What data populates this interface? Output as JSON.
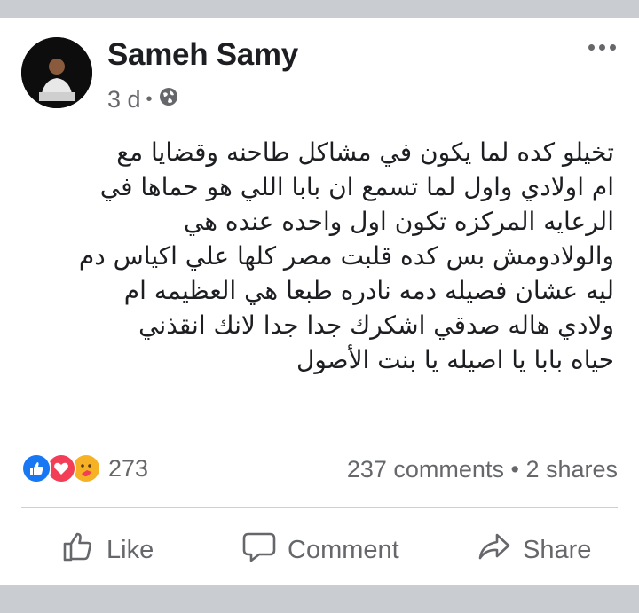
{
  "post": {
    "author": "Sameh Samy",
    "time": "3 d",
    "text_lines": [
      "تخيلو كده لما يكون في مشاكل طاحنه وقضايا مع",
      "ام اولادي واول لما تسمع ان بابا اللي هو حماها في",
      "الرعايه المركزه تكون اول واحده عنده هي",
      "والولادومش بس كده قلبت مصر كلها علي اكياس دم",
      "ليه عشان فصيله دمه نادره طبعا هي العظيمه ام",
      "ولادي هاله صدقي اشكرك جدا جدا لانك انقذني",
      "حياه بابا يا اصيله يا بنت الأصول"
    ]
  },
  "reactions": {
    "count": "273",
    "comments": "237 comments",
    "shares": "2 shares",
    "separator": "•"
  },
  "actions": {
    "like": "Like",
    "comment": "Comment",
    "share": "Share"
  },
  "colors": {
    "like_blue": "#1877f2",
    "love_red": "#f33e58",
    "care_yellow": "#f7b125",
    "muted": "#65676b"
  }
}
